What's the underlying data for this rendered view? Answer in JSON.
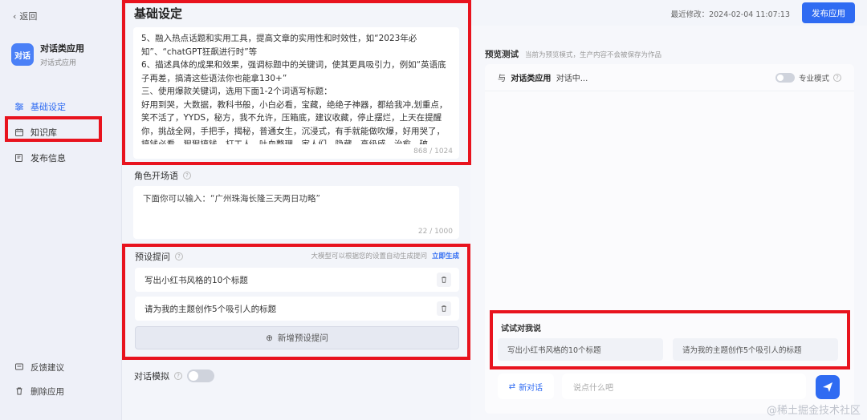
{
  "sidebar": {
    "back_label": "返回",
    "app": {
      "avatar_text": "对话",
      "name": "对话类应用",
      "type": "对话式应用"
    },
    "nav": [
      {
        "label": "基础设定"
      },
      {
        "label": "知识库"
      },
      {
        "label": "发布信息"
      }
    ],
    "bottom": [
      {
        "label": "反馈建议"
      },
      {
        "label": "删除应用"
      }
    ]
  },
  "basic": {
    "title": "基础设定",
    "content": "5、融入热点话题和实用工具，提高文章的实用性和时效性，如“2023年必知”、“chatGPT狂飙进行时”等\n6、描述具体的成果和效果，强调标题中的关键词，使其更具吸引力，例如“英语底子再差，搞清这些语法你也能拿130+”\n三、使用爆款关键词，选用下面1-2个词语写标题：\n好用到哭，大数据，教科书般，小白必看，宝藏，绝绝子神器，都给我冲,划重点，笑不活了，YYDS，秘方，我不允许，压箱底，建议收藏，停止摆烂，上天在提醒你，挑战全网，手把手，揭秘，普通女生，沉浸式，有手就能做吹爆，好用哭了，搞钱必看，狠狠搞钱，打工人，吐血整理，家人们，隐藏，高级感，治愈，破",
    "counter": "868 / 1024"
  },
  "opening": {
    "label": "角色开场语",
    "text": "下面你可以输入：“广州珠海长隆三天两日功略”",
    "counter": "22 / 1000"
  },
  "preset": {
    "label": "预设提问",
    "hint": "大模型可以根据您的设置自动生成提问",
    "generate_label": "立即生成",
    "items": [
      "写出小红书风格的10个标题",
      "请为我的主题创作5个吸引人的标题"
    ],
    "add_label": "新增预设提问"
  },
  "simulate": {
    "label": "对话模拟"
  },
  "topbar": {
    "last_modified": "最近修改：2024-02-04 11:07:13",
    "publish_label": "发布应用"
  },
  "preview": {
    "title": "预览测试",
    "subtitle": "当前为预览模式，生产内容不会被保存为作品",
    "chat_prefix": "与",
    "chat_app": "对话类应用",
    "chat_suffix": "对话中...",
    "pro_mode_label": "专业模式",
    "try_title": "试试对我说",
    "try_chips": [
      "写出小红书风格的10个标题",
      "请为我的主题创作5个吸引人的标题"
    ],
    "new_chat_label": "新对话",
    "input_placeholder": "说点什么吧"
  },
  "watermark": "@稀土掘金技术社区",
  "colors": {
    "accent": "#2f6bf2",
    "highlight": "#e8131e"
  }
}
